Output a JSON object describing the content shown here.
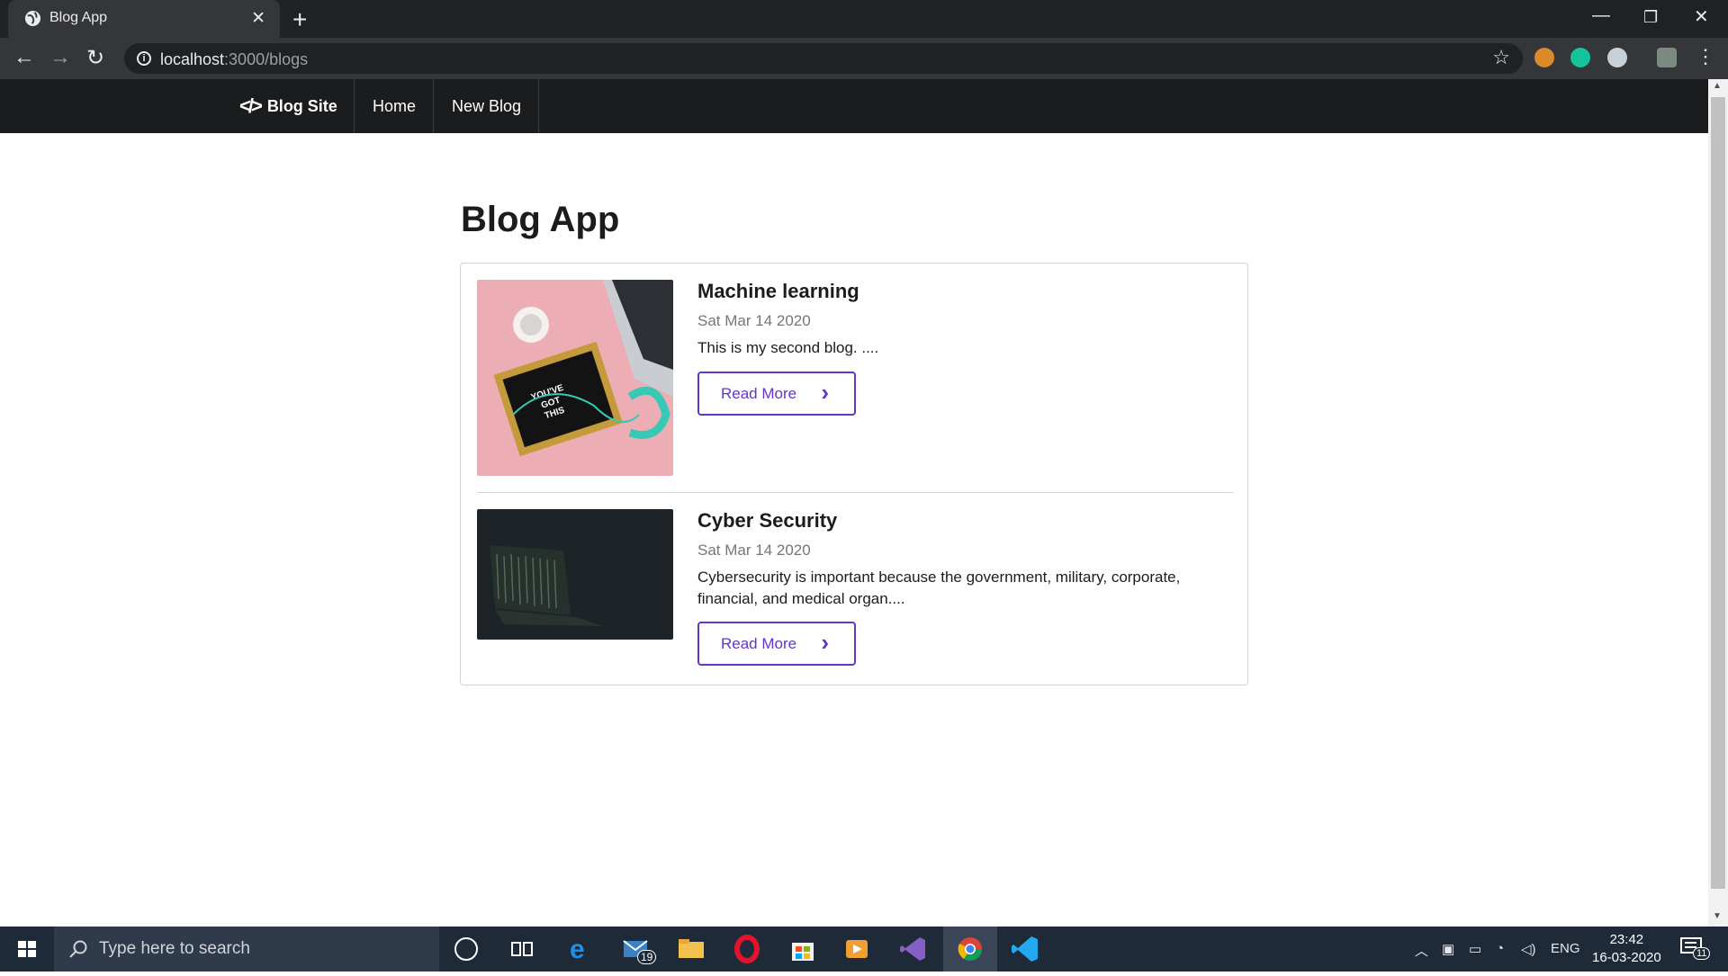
{
  "browser": {
    "tab_title": "Blog App",
    "url_host": "localhost",
    "url_rest": ":3000/blogs"
  },
  "navbar": {
    "brand": "Blog Site",
    "links": [
      "Home",
      "New Blog"
    ]
  },
  "page": {
    "title": "Blog App",
    "blogs": [
      {
        "title": "Machine learning",
        "date": "Sat Mar 14 2020",
        "description": "This is my second blog. ....",
        "button": "Read More",
        "image_caption": [
          "YOU'VE",
          "GOT",
          "THIS"
        ]
      },
      {
        "title": "Cyber Security",
        "date": "Sat Mar 14 2020",
        "description": "Cybersecurity is important because the government, military, corporate, financial, and medical organ....",
        "button": "Read More"
      }
    ]
  },
  "taskbar": {
    "search_placeholder": "Type here to search",
    "mail_badge": "19",
    "language": "ENG",
    "time": "23:42",
    "date": "16-03-2020",
    "notifications": "11"
  },
  "colors": {
    "accent": "#6435c9",
    "navbar_bg": "#1b1c1d",
    "chrome_bg": "#202124"
  }
}
